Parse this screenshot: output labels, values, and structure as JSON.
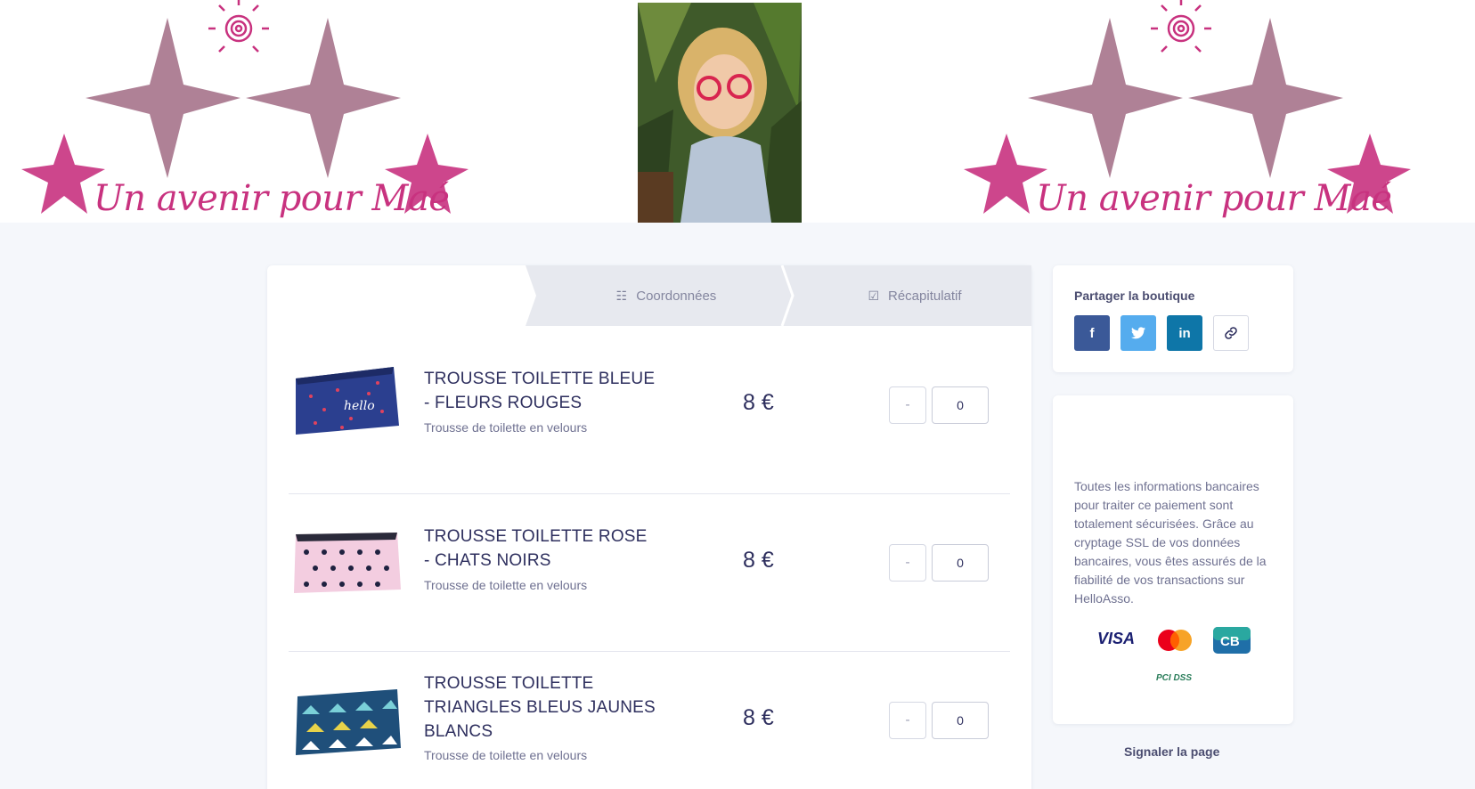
{
  "banner": {
    "left_title": "Un avenir pour Maé",
    "right_title": "Un avenir pour Maé"
  },
  "steps": [
    {
      "label": "Coordonnées",
      "icon": "list-icon"
    },
    {
      "label": "Récapitulatif",
      "icon": "checkbox-icon"
    }
  ],
  "products": [
    {
      "name": "TROUSSE TOILETTE BLEUE - FLEURS ROUGES",
      "description": "Trousse de toilette en velours",
      "price": "8 €",
      "quantity": "0",
      "minus": "-",
      "pattern_label": "hello"
    },
    {
      "name": "TROUSSE TOILETTE ROSE - CHATS NOIRS",
      "description": "Trousse de toilette en velours",
      "price": "8 €",
      "quantity": "0",
      "minus": "-"
    },
    {
      "name": "TROUSSE TOILETTE TRIANGLES BLEUS JAUNES BLANCS",
      "description": "Trousse de toilette en velours",
      "price": "8 €",
      "quantity": "0",
      "minus": "-"
    }
  ],
  "share": {
    "title": "Partager la boutique",
    "buttons": [
      {
        "icon": "facebook-icon",
        "glyph": "f",
        "color": "#3b5998"
      },
      {
        "icon": "twitter-icon",
        "glyph": "t",
        "color": "#55acee"
      },
      {
        "icon": "linkedin-icon",
        "glyph": "in",
        "color": "#0e76a8"
      },
      {
        "icon": "link-icon",
        "glyph": "🔗",
        "color": "#ffffff"
      }
    ]
  },
  "security": {
    "text": "Toutes les informations bancaires pour traiter ce paiement sont totalement sécurisées. Grâce au cryptage SSL de vos données bancaires, vous êtes assurés de la fiabilité de vos transactions sur HelloAsso.",
    "logos": [
      "VISA",
      "mastercard",
      "CB",
      "PCI DSS"
    ]
  },
  "footer": {
    "report_label": "Signaler la page"
  },
  "colors": {
    "page_bg": "#f5f7fb",
    "text_primary": "#2e2f5e",
    "brand_pink": "#c8327f",
    "star_mauve": "#a16b84"
  }
}
